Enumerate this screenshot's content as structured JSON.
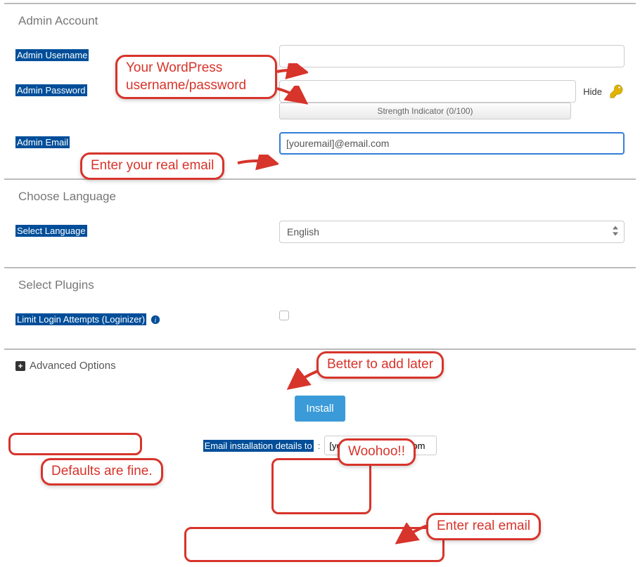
{
  "admin": {
    "title": "Admin Account",
    "username_label": "Admin Username",
    "password_label": "Admin Password",
    "hide_label": "Hide",
    "strength_text": "Strength Indicator (0/100)",
    "email_label": "Admin Email",
    "email_value": "[youremail]@email.com"
  },
  "language": {
    "title": "Choose Language",
    "label": "Select Language",
    "value": "English"
  },
  "plugins": {
    "title": "Select Plugins",
    "limit_login_label": "Limit Login Attempts (Loginizer)"
  },
  "advanced": {
    "label": "Advanced Options"
  },
  "install": {
    "button": "Install",
    "email_details_label": "Email installation details to",
    "email_details_value": "[youremail]@email.com"
  },
  "annotations": {
    "userpass": "Your WordPress username/password",
    "real_email": "Enter your real email",
    "add_later": "Better to add later",
    "defaults": "Defaults are fine.",
    "woohoo": "Woohoo!!",
    "enter_real_email_2": "Enter real email"
  }
}
